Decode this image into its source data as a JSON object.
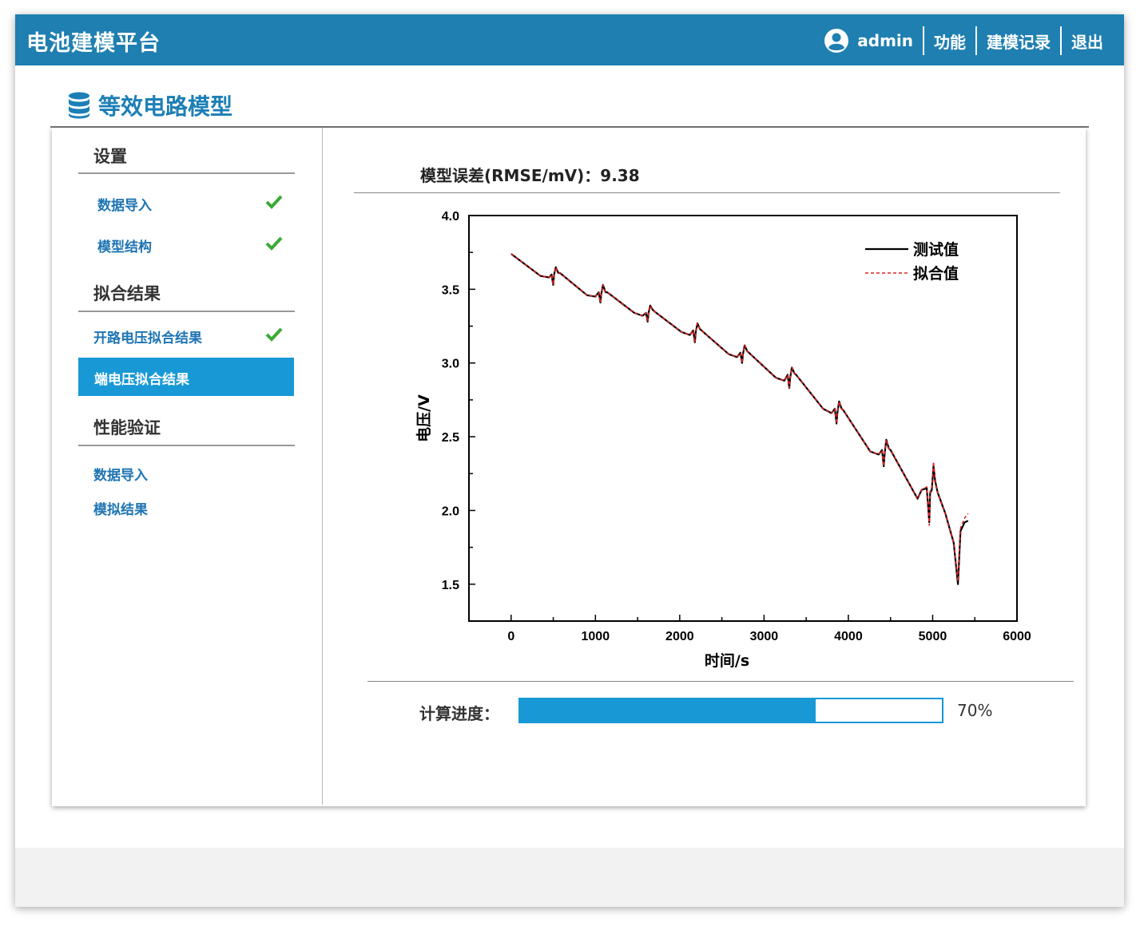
{
  "header": {
    "app_title": "电池建模平台",
    "user": "admin",
    "nav": [
      "功能",
      "建模记录",
      "退出"
    ]
  },
  "page": {
    "title": "等效电路模型",
    "icon": "database-icon"
  },
  "sidebar": {
    "sections": [
      {
        "title": "设置",
        "items": [
          {
            "label": "数据导入",
            "done": true
          },
          {
            "label": "模型结构",
            "done": true
          }
        ]
      },
      {
        "title": "拟合结果",
        "items": [
          {
            "label": "开路电压拟合结果",
            "done": true
          },
          {
            "label": "端电压拟合结果",
            "active": true
          }
        ]
      },
      {
        "title": "性能验证",
        "items": [
          {
            "label": "数据导入"
          },
          {
            "label": "模拟结果"
          }
        ]
      }
    ]
  },
  "main": {
    "rmse_text": "模型误差(RMSE/mV)：9.38",
    "progress_label": "计算进度：",
    "progress_value": 0.7,
    "progress_text": "70%"
  },
  "colors": {
    "header": "#1f7fb1",
    "accent": "#1899d6",
    "check": "#3aaa35",
    "fit_line": "#e02020"
  },
  "chart_data": {
    "type": "line",
    "xlabel": "时间/s",
    "ylabel": "电压/V",
    "xlim": [
      -500,
      6000
    ],
    "ylim": [
      1.25,
      4.0
    ],
    "xticks": [
      0,
      1000,
      2000,
      3000,
      4000,
      5000,
      6000
    ],
    "yticks": [
      1.5,
      2.0,
      2.5,
      3.0,
      3.5,
      4.0
    ],
    "legend_position": "top-right",
    "series": [
      {
        "name": "测试值",
        "color": "#000000",
        "style": "solid",
        "points": [
          [
            0,
            3.74
          ],
          [
            350,
            3.59
          ],
          [
            450,
            3.58
          ],
          [
            480,
            3.6
          ],
          [
            500,
            3.53
          ],
          [
            510,
            3.6
          ],
          [
            530,
            3.65
          ],
          [
            560,
            3.61
          ],
          [
            580,
            3.61
          ],
          [
            900,
            3.46
          ],
          [
            1000,
            3.45
          ],
          [
            1040,
            3.48
          ],
          [
            1060,
            3.41
          ],
          [
            1070,
            3.47
          ],
          [
            1090,
            3.53
          ],
          [
            1120,
            3.48
          ],
          [
            1140,
            3.48
          ],
          [
            1460,
            3.34
          ],
          [
            1560,
            3.32
          ],
          [
            1600,
            3.34
          ],
          [
            1620,
            3.28
          ],
          [
            1630,
            3.34
          ],
          [
            1650,
            3.39
          ],
          [
            1680,
            3.36
          ],
          [
            1700,
            3.35
          ],
          [
            2020,
            3.21
          ],
          [
            2120,
            3.19
          ],
          [
            2160,
            3.22
          ],
          [
            2180,
            3.14
          ],
          [
            2190,
            3.21
          ],
          [
            2210,
            3.27
          ],
          [
            2240,
            3.23
          ],
          [
            2260,
            3.22
          ],
          [
            2580,
            3.06
          ],
          [
            2680,
            3.04
          ],
          [
            2720,
            3.07
          ],
          [
            2740,
            3.0
          ],
          [
            2750,
            3.06
          ],
          [
            2770,
            3.12
          ],
          [
            2800,
            3.08
          ],
          [
            2820,
            3.07
          ],
          [
            3140,
            2.9
          ],
          [
            3240,
            2.88
          ],
          [
            3280,
            2.92
          ],
          [
            3300,
            2.83
          ],
          [
            3310,
            2.9
          ],
          [
            3330,
            2.97
          ],
          [
            3360,
            2.93
          ],
          [
            3380,
            2.92
          ],
          [
            3700,
            2.69
          ],
          [
            3800,
            2.66
          ],
          [
            3840,
            2.69
          ],
          [
            3860,
            2.59
          ],
          [
            3870,
            2.66
          ],
          [
            3890,
            2.74
          ],
          [
            3920,
            2.69
          ],
          [
            3940,
            2.68
          ],
          [
            4260,
            2.4
          ],
          [
            4360,
            2.38
          ],
          [
            4400,
            2.41
          ],
          [
            4420,
            2.3
          ],
          [
            4430,
            2.38
          ],
          [
            4450,
            2.48
          ],
          [
            4480,
            2.42
          ],
          [
            4500,
            2.41
          ],
          [
            4820,
            2.08
          ],
          [
            4870,
            2.14
          ],
          [
            4930,
            2.15
          ],
          [
            4960,
            1.92
          ],
          [
            4970,
            2.12
          ],
          [
            4990,
            2.14
          ],
          [
            5010,
            2.3
          ],
          [
            5030,
            2.2
          ],
          [
            5060,
            2.12
          ],
          [
            5150,
            1.98
          ],
          [
            5250,
            1.78
          ],
          [
            5300,
            1.5
          ],
          [
            5330,
            1.86
          ],
          [
            5380,
            1.92
          ],
          [
            5420,
            1.93
          ]
        ]
      },
      {
        "name": "拟合值",
        "color": "#e02020",
        "style": "dashed",
        "points": [
          [
            0,
            3.74
          ],
          [
            350,
            3.59
          ],
          [
            450,
            3.58
          ],
          [
            480,
            3.6
          ],
          [
            500,
            3.53
          ],
          [
            510,
            3.6
          ],
          [
            530,
            3.65
          ],
          [
            560,
            3.61
          ],
          [
            580,
            3.61
          ],
          [
            900,
            3.46
          ],
          [
            1000,
            3.45
          ],
          [
            1040,
            3.48
          ],
          [
            1060,
            3.41
          ],
          [
            1070,
            3.47
          ],
          [
            1090,
            3.53
          ],
          [
            1120,
            3.48
          ],
          [
            1140,
            3.48
          ],
          [
            1460,
            3.34
          ],
          [
            1560,
            3.32
          ],
          [
            1600,
            3.34
          ],
          [
            1620,
            3.28
          ],
          [
            1630,
            3.34
          ],
          [
            1650,
            3.39
          ],
          [
            1680,
            3.36
          ],
          [
            1700,
            3.35
          ],
          [
            2020,
            3.21
          ],
          [
            2120,
            3.19
          ],
          [
            2160,
            3.22
          ],
          [
            2180,
            3.14
          ],
          [
            2190,
            3.21
          ],
          [
            2210,
            3.27
          ],
          [
            2240,
            3.23
          ],
          [
            2260,
            3.22
          ],
          [
            2580,
            3.06
          ],
          [
            2680,
            3.04
          ],
          [
            2720,
            3.07
          ],
          [
            2740,
            3.0
          ],
          [
            2750,
            3.06
          ],
          [
            2770,
            3.12
          ],
          [
            2800,
            3.08
          ],
          [
            2820,
            3.07
          ],
          [
            3140,
            2.9
          ],
          [
            3240,
            2.88
          ],
          [
            3280,
            2.92
          ],
          [
            3300,
            2.83
          ],
          [
            3310,
            2.9
          ],
          [
            3330,
            2.97
          ],
          [
            3360,
            2.93
          ],
          [
            3380,
            2.92
          ],
          [
            3700,
            2.69
          ],
          [
            3800,
            2.66
          ],
          [
            3840,
            2.69
          ],
          [
            3860,
            2.59
          ],
          [
            3870,
            2.66
          ],
          [
            3890,
            2.74
          ],
          [
            3920,
            2.69
          ],
          [
            3940,
            2.68
          ],
          [
            4260,
            2.4
          ],
          [
            4360,
            2.38
          ],
          [
            4400,
            2.41
          ],
          [
            4420,
            2.3
          ],
          [
            4430,
            2.38
          ],
          [
            4450,
            2.48
          ],
          [
            4480,
            2.42
          ],
          [
            4500,
            2.41
          ],
          [
            4820,
            2.08
          ],
          [
            4870,
            2.14
          ],
          [
            4930,
            2.16
          ],
          [
            4960,
            1.9
          ],
          [
            4970,
            2.13
          ],
          [
            4990,
            2.15
          ],
          [
            5010,
            2.33
          ],
          [
            5030,
            2.21
          ],
          [
            5060,
            2.12
          ],
          [
            5150,
            1.98
          ],
          [
            5250,
            1.78
          ],
          [
            5300,
            1.52
          ],
          [
            5330,
            1.88
          ],
          [
            5380,
            1.95
          ],
          [
            5420,
            1.98
          ]
        ]
      }
    ]
  }
}
